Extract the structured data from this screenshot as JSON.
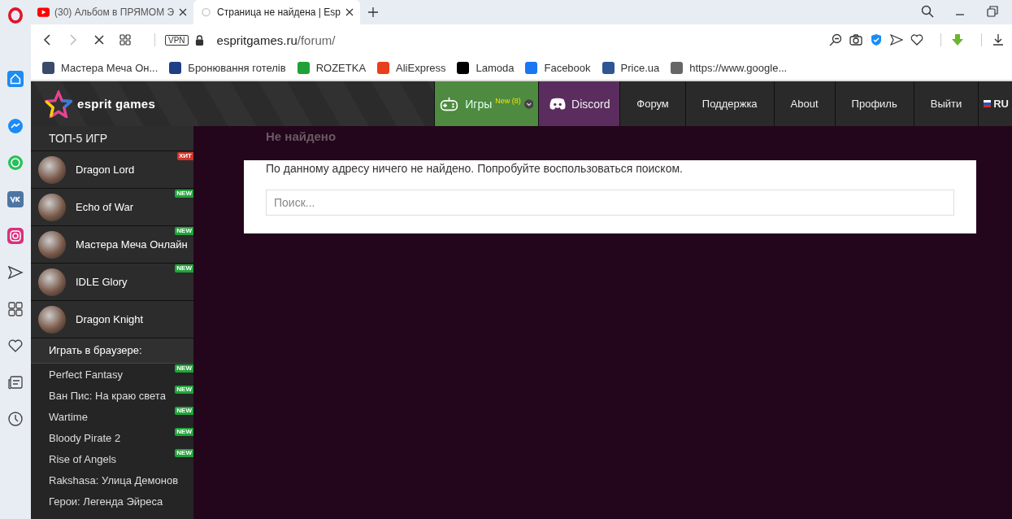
{
  "browser": {
    "tabs": [
      {
        "title": "(30) Альбом в ПРЯМОМ Э",
        "selected": false,
        "kind": "video"
      },
      {
        "title": "Страница не найдена | Esp",
        "selected": true,
        "kind": "loading"
      }
    ],
    "address": {
      "vpn": "VPN",
      "domain": "espritgames.ru",
      "path": "/forum/"
    },
    "bookmarks": [
      {
        "label": "Мастера Меча Он...",
        "color": "#3b4a6b"
      },
      {
        "label": "Бронювання готелів",
        "color": "#1d3f87"
      },
      {
        "label": "ROZETKA",
        "color": "#21a038"
      },
      {
        "label": "AliExpress",
        "color": "#e8401c"
      },
      {
        "label": "Lamoda",
        "color": "#000000"
      },
      {
        "label": "Facebook",
        "color": "#1877f2"
      },
      {
        "label": "Price.ua",
        "color": "#2f5597"
      },
      {
        "label": "https://www.google...",
        "color": "#666666"
      }
    ]
  },
  "site": {
    "logo": "esprit games",
    "nav": [
      {
        "label": "Игры",
        "kind": "games",
        "badge": "New (8)"
      },
      {
        "label": "Discord",
        "kind": "discord"
      },
      {
        "label": "Форум",
        "kind": "plain"
      },
      {
        "label": "Поддержка",
        "kind": "plain"
      },
      {
        "label": "About",
        "kind": "plain"
      },
      {
        "label": "Профиль",
        "kind": "plain"
      },
      {
        "label": "Выйти",
        "kind": "plain"
      },
      {
        "label": "RU",
        "kind": "lang"
      }
    ],
    "sidebar": {
      "top_title": "ТОП-5 ИГР",
      "top_games": [
        {
          "name": "Dragon Lord",
          "badge": "ХИТ",
          "kind": "hit"
        },
        {
          "name": "Echo of War",
          "badge": "NEW",
          "kind": "new"
        },
        {
          "name": "Мастера Меча Онлайн",
          "badge": "NEW",
          "kind": "new"
        },
        {
          "name": "IDLE Glory",
          "badge": "NEW",
          "kind": "new"
        },
        {
          "name": "Dragon Knight",
          "kind": "none"
        }
      ],
      "browser_title": "Играть в браузере:",
      "browser_games": [
        {
          "name": "Perfect Fantasy",
          "badge": "NEW"
        },
        {
          "name": "Ван Пис: На краю света",
          "badge": "NEW"
        },
        {
          "name": "Wartime",
          "badge": "NEW"
        },
        {
          "name": "Bloody Pirate 2",
          "badge": "NEW"
        },
        {
          "name": "Rise of Angels",
          "badge": "NEW"
        },
        {
          "name": "Rakshasa: Улица Демонов"
        },
        {
          "name": "Герои: Легенда Эйреса"
        }
      ]
    },
    "page_title": "Не найдено",
    "message": "По данному адресу ничего не найдено. Попробуйте воспользоваться поиском.",
    "search": {
      "placeholder": "Поиск..."
    }
  }
}
